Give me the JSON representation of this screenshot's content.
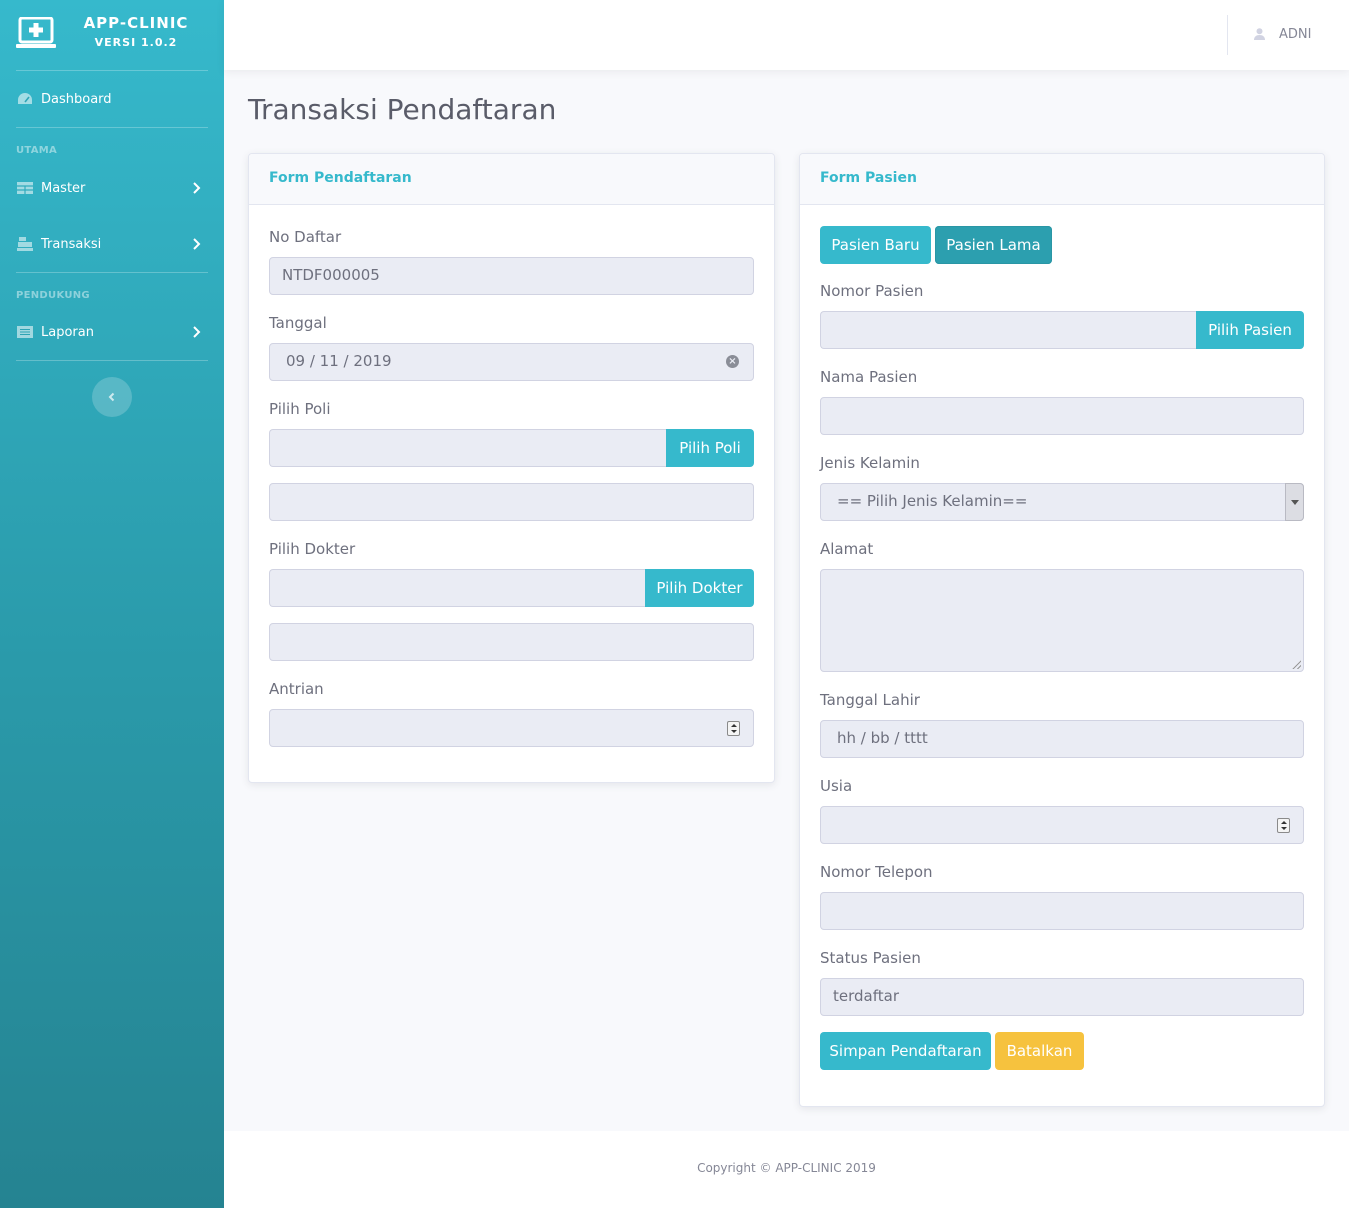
{
  "brand": {
    "title": "APP-CLINIC",
    "version": "VERSI 1.0.2",
    "icon": "clinic-laptop-icon"
  },
  "sidebar": {
    "dashboard": {
      "label": "Dashboard",
      "icon": "tachometer-icon"
    },
    "heading_utama": "UTAMA",
    "master": {
      "label": "Master",
      "icon": "table-icon"
    },
    "transaksi": {
      "label": "Transaksi",
      "icon": "cash-register-icon"
    },
    "heading_pendukung": "PENDUKUNG",
    "laporan": {
      "label": "Laporan",
      "icon": "list-icon"
    },
    "toggle_icon": "chevron-left-icon"
  },
  "topbar": {
    "user_name": "ADNI",
    "user_icon": "user-icon"
  },
  "page": {
    "title": "Transaksi Pendaftaran"
  },
  "form_pendaftaran": {
    "header": "Form Pendaftaran",
    "no_daftar_label": "No Daftar",
    "no_daftar_value": "NTDF000005",
    "tanggal_label": "Tanggal",
    "tanggal_value": "09 / 11 / 2019",
    "poli_label": "Pilih Poli",
    "poli_button": "Pilih Poli",
    "poli_value": "",
    "poli_name_value": "",
    "dokter_label": "Pilih Dokter",
    "dokter_button": "Pilih Dokter",
    "dokter_value": "",
    "dokter_name_value": "",
    "antrian_label": "Antrian",
    "antrian_value": ""
  },
  "form_pasien": {
    "header": "Form Pasien",
    "btn_pasien_baru": "Pasien Baru",
    "btn_pasien_lama": "Pasien Lama",
    "nomor_label": "Nomor Pasien",
    "nomor_value": "",
    "pilih_pasien_button": "Pilih Pasien",
    "nama_label": "Nama Pasien",
    "nama_value": "",
    "jk_label": "Jenis Kelamin",
    "jk_selected": "== Pilih Jenis Kelamin==",
    "alamat_label": "Alamat",
    "alamat_value": "",
    "tgl_lahir_label": "Tanggal Lahir",
    "tgl_lahir_placeholder": "hh / bb / tttt",
    "usia_label": "Usia",
    "usia_value": "",
    "telp_label": "Nomor Telepon",
    "telp_value": "",
    "status_label": "Status Pasien",
    "status_value": "terdaftar",
    "btn_simpan": "Simpan Pendaftaran",
    "btn_batal": "Batalkan"
  },
  "colors": {
    "primary": "#36b9cc",
    "warning": "#f6c23e",
    "text": "#5a5c69"
  },
  "footer": {
    "copyright": "Copyright © APP-CLINIC 2019"
  }
}
